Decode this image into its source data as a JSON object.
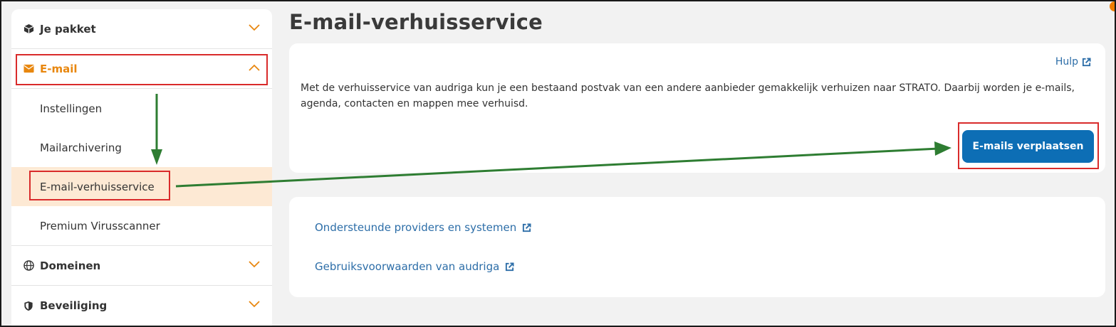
{
  "sidebar": {
    "items": [
      {
        "label": "Je pakket",
        "icon": "box-icon"
      },
      {
        "label": "E-mail",
        "icon": "envelope-icon"
      },
      {
        "label": "Domeinen",
        "icon": "globe-icon"
      },
      {
        "label": "Beveiliging",
        "icon": "shield-icon"
      }
    ],
    "email_subitems": [
      {
        "label": "Instellingen"
      },
      {
        "label": "Mailarchivering"
      },
      {
        "label": "E-mail-verhuisservice"
      },
      {
        "label": "Premium Virusscanner"
      }
    ]
  },
  "main": {
    "title": "E-mail-verhuisservice",
    "help_label": "Hulp",
    "description": "Met de verhuisservice van audriga kun je een bestaand postvak van een andere aanbieder gemakkelijk verhuizen naar STRATO. Daarbij worden je e-mails, agenda, contacten en mappen mee verhuisd.",
    "primary_button": "E-mails verplaatsen",
    "links": [
      {
        "label": "Ondersteunde providers en systemen"
      },
      {
        "label": "Gebruiksvoorwaarden van audriga"
      }
    ]
  },
  "colors": {
    "accent_orange": "#e8870f",
    "link_blue": "#2d6ea8",
    "button_blue": "#0d6eb5",
    "active_bg": "#fde9d4",
    "annotation_red": "#d92b2b",
    "annotation_green": "#2e7d32"
  }
}
